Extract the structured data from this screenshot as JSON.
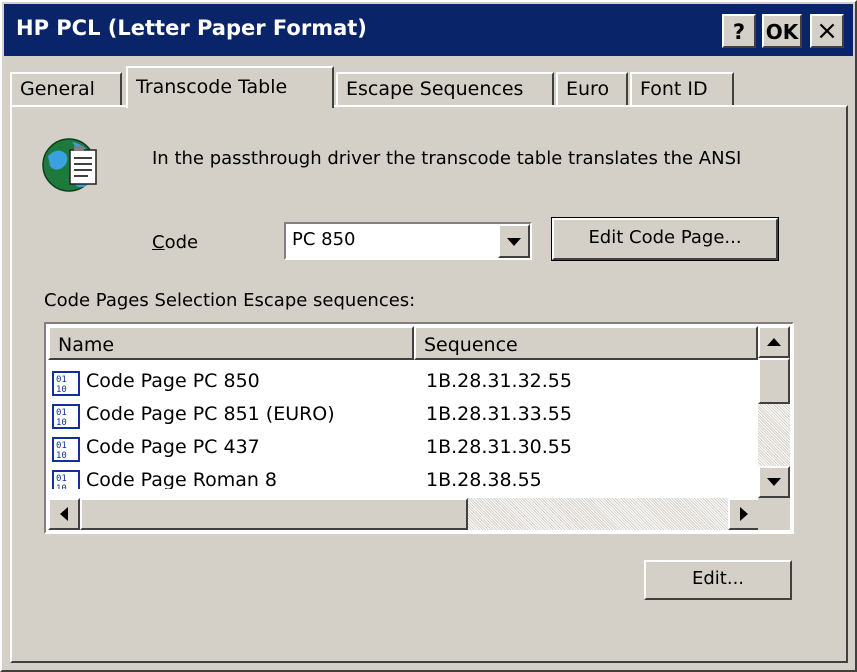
{
  "window": {
    "title": "HP PCL (Letter Paper Format)",
    "help_label": "?",
    "ok_label": "OK",
    "close_label": "×"
  },
  "tabs": [
    {
      "label": "General",
      "active": false
    },
    {
      "label": "Transcode Table",
      "active": true
    },
    {
      "label": "Escape Sequences",
      "active": false
    },
    {
      "label": "Euro",
      "active": false
    },
    {
      "label": "Font ID",
      "active": false
    }
  ],
  "panel": {
    "icon": "globe-document-icon",
    "description": "In the passthrough driver the transcode table translates the ANSI",
    "code_label": "Code",
    "code_value": "PC 850",
    "edit_code_page_label": "Edit Code Page...",
    "list_caption": "Code Pages Selection Escape sequences:",
    "columns": [
      "Name",
      "Sequence"
    ],
    "rows": [
      {
        "name": "Code Page PC 850",
        "sequence": "1B.28.31.32.55"
      },
      {
        "name": "Code Page PC 851 (EURO)",
        "sequence": "1B.28.31.33.55"
      },
      {
        "name": "Code Page PC 437",
        "sequence": "1B.28.31.30.55"
      },
      {
        "name": "Code Page Roman 8",
        "sequence": "1B.28.38.55"
      }
    ],
    "edit_label": "Edit..."
  },
  "colors": {
    "titlebar": "#0a246a",
    "face": "#d4d0c8"
  }
}
